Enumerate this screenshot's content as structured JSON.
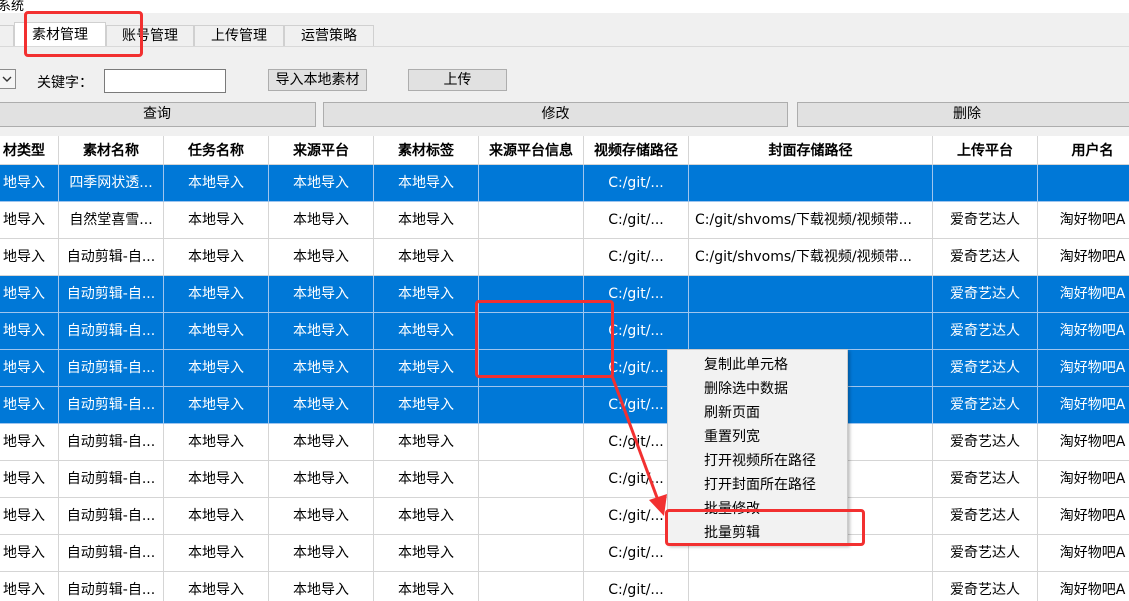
{
  "window": {
    "title_fragment": "系统"
  },
  "tabs": [
    {
      "label": "素材管理",
      "active": true
    },
    {
      "label": "账号管理",
      "active": false
    },
    {
      "label": "上传管理",
      "active": false
    },
    {
      "label": "运营策略",
      "active": false
    }
  ],
  "toolbar": {
    "keyword_label": "关键字：",
    "keyword_value": "",
    "import_label": "导入本地素材",
    "upload_label": "上传",
    "query_label": "查询",
    "modify_label": "修改",
    "delete_label": "删除"
  },
  "table": {
    "headers": [
      "材类型",
      "素材名称",
      "任务名称",
      "来源平台",
      "素材标签",
      "来源平台信息",
      "视频存储路径",
      "封面存储路径",
      "上传平台",
      "用户名"
    ],
    "rows": [
      {
        "selected": true,
        "cells": [
          "地导入",
          "四季网状透...",
          "本地导入",
          "本地导入",
          "本地导入",
          "",
          "C:/git/...",
          "",
          "",
          ""
        ]
      },
      {
        "selected": false,
        "cells": [
          "地导入",
          "自然堂喜雪...",
          "本地导入",
          "本地导入",
          "本地导入",
          "",
          "C:/git/...",
          "C:/git/shvoms/下载视频/视频带...",
          "爱奇艺达人",
          "淘好物吧A"
        ]
      },
      {
        "selected": false,
        "cells": [
          "地导入",
          "自动剪辑-自...",
          "本地导入",
          "本地导入",
          "本地导入",
          "",
          "C:/git/...",
          "C:/git/shvoms/下载视频/视频带...",
          "爱奇艺达人",
          "淘好物吧A"
        ]
      },
      {
        "selected": true,
        "cells": [
          "地导入",
          "自动剪辑-自...",
          "本地导入",
          "本地导入",
          "本地导入",
          "",
          "C:/git/...",
          "",
          "爱奇艺达人",
          "淘好物吧A"
        ]
      },
      {
        "selected": true,
        "cells": [
          "地导入",
          "自动剪辑-自...",
          "本地导入",
          "本地导入",
          "本地导入",
          "",
          "C:/git/...",
          "",
          "爱奇艺达人",
          "淘好物吧A"
        ]
      },
      {
        "selected": true,
        "cells": [
          "地导入",
          "自动剪辑-自...",
          "本地导入",
          "本地导入",
          "本地导入",
          "",
          "C:/git/...",
          "",
          "爱奇艺达人",
          "淘好物吧A"
        ]
      },
      {
        "selected": true,
        "cells": [
          "地导入",
          "自动剪辑-自...",
          "本地导入",
          "本地导入",
          "本地导入",
          "",
          "C:/git/...",
          "",
          "爱奇艺达人",
          "淘好物吧A"
        ]
      },
      {
        "selected": false,
        "cells": [
          "地导入",
          "自动剪辑-自...",
          "本地导入",
          "本地导入",
          "本地导入",
          "",
          "C:/git/...",
          "",
          "爱奇艺达人",
          "淘好物吧A"
        ]
      },
      {
        "selected": false,
        "cells": [
          "地导入",
          "自动剪辑-自...",
          "本地导入",
          "本地导入",
          "本地导入",
          "",
          "C:/git/...",
          "",
          "爱奇艺达人",
          "淘好物吧A"
        ]
      },
      {
        "selected": false,
        "cells": [
          "地导入",
          "自动剪辑-自...",
          "本地导入",
          "本地导入",
          "本地导入",
          "",
          "C:/git/...",
          "",
          "爱奇艺达人",
          "淘好物吧A"
        ]
      },
      {
        "selected": false,
        "cells": [
          "地导入",
          "自动剪辑-自...",
          "本地导入",
          "本地导入",
          "本地导入",
          "",
          "C:/git/...",
          "",
          "爱奇艺达人",
          "淘好物吧A"
        ]
      },
      {
        "selected": false,
        "cells": [
          "地导入",
          "自动剪辑-自...",
          "本地导入",
          "本地导入",
          "本地导入",
          "",
          "C:/git/...",
          "",
          "爱奇艺达人",
          "淘好物吧A"
        ]
      }
    ]
  },
  "context_menu": {
    "items": [
      "复制此单元格",
      "删除选中数据",
      "刷新页面",
      "重置列宽",
      "打开视频所在路径",
      "打开封面所在路径",
      "批量修改",
      "批量剪辑"
    ]
  },
  "colors": {
    "selection": "#0078d7",
    "annotation": "#f23030",
    "window_bg": "#f0f0f0"
  }
}
